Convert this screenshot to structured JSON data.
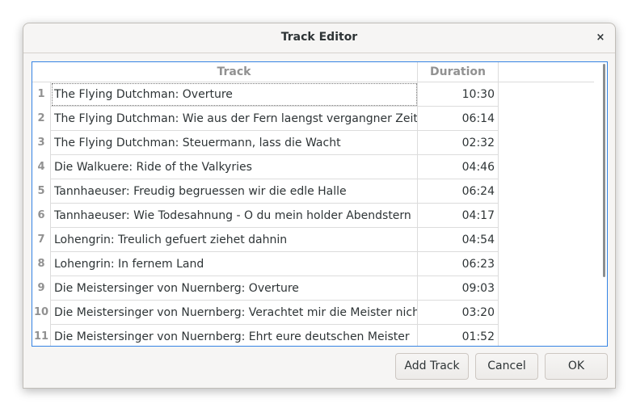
{
  "window": {
    "title": "Track Editor",
    "close_label": "×"
  },
  "table": {
    "columns": [
      "Track",
      "Duration"
    ],
    "rows": [
      {
        "num": "1",
        "track": "The Flying Dutchman: Overture",
        "duration": "10:30"
      },
      {
        "num": "2",
        "track": "The Flying Dutchman: Wie aus der Fern laengst vergangner Zeiten",
        "duration": "06:14"
      },
      {
        "num": "3",
        "track": "The Flying Dutchman: Steuermann, lass die Wacht",
        "duration": "02:32"
      },
      {
        "num": "4",
        "track": "Die Walkuere: Ride of the Valkyries",
        "duration": "04:46"
      },
      {
        "num": "5",
        "track": "Tannhaeuser: Freudig begruessen wir die edle Halle",
        "duration": "06:24"
      },
      {
        "num": "6",
        "track": "Tannhaeuser: Wie Todesahnung - O du mein holder Abendstern",
        "duration": "04:17"
      },
      {
        "num": "7",
        "track": "Lohengrin: Treulich gefuert ziehet dahnin",
        "duration": "04:54"
      },
      {
        "num": "8",
        "track": "Lohengrin: In fernem Land",
        "duration": "06:23"
      },
      {
        "num": "9",
        "track": "Die Meistersinger von Nuernberg: Overture",
        "duration": "09:03"
      },
      {
        "num": "10",
        "track": "Die Meistersinger von Nuernberg: Verachtet mir die Meister nicht",
        "duration": "03:20"
      },
      {
        "num": "11",
        "track": "Die Meistersinger von Nuernberg: Ehrt eure deutschen Meister",
        "duration": "01:52"
      }
    ]
  },
  "buttons": {
    "add_track": "Add Track",
    "cancel": "Cancel",
    "ok": "OK"
  },
  "colors": {
    "focus_border": "#3584e4",
    "header_text": "#919191",
    "text": "#2e3436"
  }
}
